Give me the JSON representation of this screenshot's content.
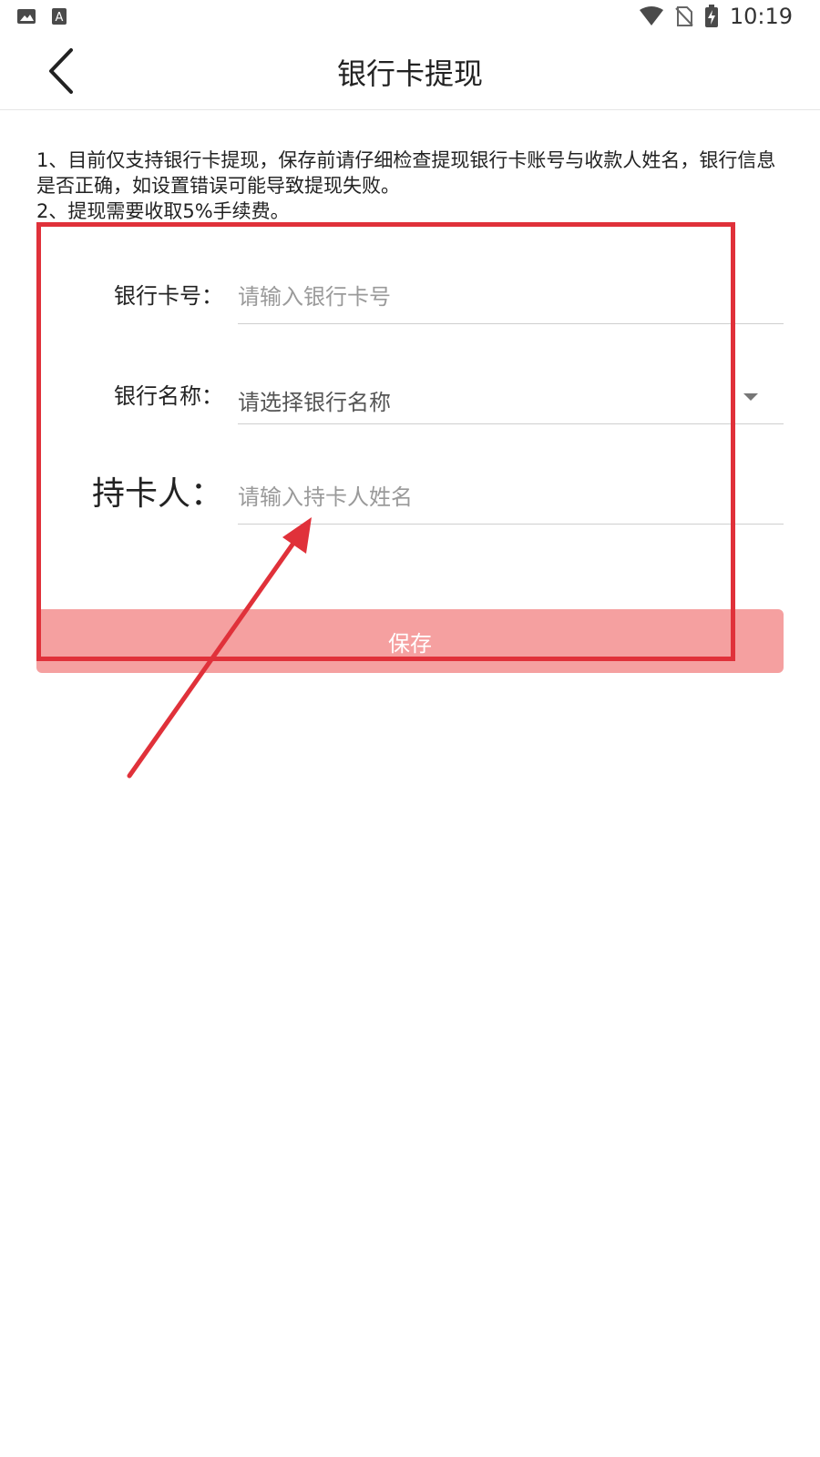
{
  "status_bar": {
    "left_icons": [
      "image-icon",
      "text-a-icon"
    ],
    "right_icons": [
      "wifi-icon",
      "no-sim-icon",
      "battery-charging-icon"
    ],
    "time": "10:19"
  },
  "app_bar": {
    "title": "银行卡提现",
    "back_icon": "chevron-left-icon"
  },
  "notes": [
    "1、目前仅支持银行卡提现，保存前请仔细检查提现银行卡账号与收款人姓名，银行信息是否正确，如设置错误可能导致提现失败。",
    "2、提现需要收取5%手续费。"
  ],
  "form": {
    "card_number": {
      "label": "银行卡号：",
      "placeholder": "请输入银行卡号",
      "value": ""
    },
    "bank_name": {
      "label": "银行名称：",
      "selected": "请选择银行名称"
    },
    "card_holder": {
      "label": "持卡人：",
      "placeholder": "请输入持卡人姓名",
      "value": ""
    }
  },
  "save_button": {
    "label": "保存"
  },
  "colors": {
    "primary_soft": "#f5a0a0",
    "annotation": "#e0313a",
    "divider": "#cfcfcf"
  }
}
